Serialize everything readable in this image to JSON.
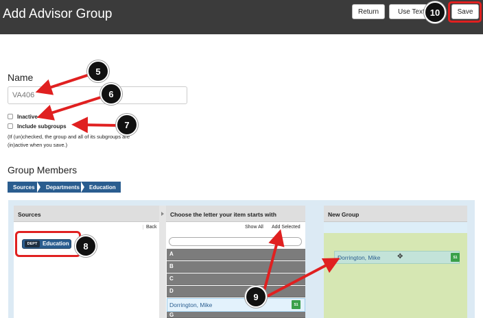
{
  "header": {
    "title": "Add Advisor Group",
    "return_label": "Return",
    "use_text_label": "Use Text",
    "save_label": "Save"
  },
  "form": {
    "name_label": "Name",
    "name_value": "VA406",
    "inactive_label": "Inactive",
    "include_subgroups_label": "Include subgroups",
    "help_text": "(If (un)checked, the group and all of its subgroups are (in)active when you save.)"
  },
  "members": {
    "title": "Group Members",
    "breadcrumb": [
      "Sources",
      "Departments",
      "Education"
    ]
  },
  "sources_panel": {
    "title": "Sources",
    "back_label": "Back",
    "item_tag": "DEPT",
    "item_label": "Education"
  },
  "letters_panel": {
    "title": "Choose the letter your item starts with",
    "show_all_label": "Show All",
    "add_selected_label": "Add Selected",
    "letters": [
      "A",
      "B",
      "C",
      "D"
    ],
    "selected_item": "Dorrington, Mike",
    "selected_badge": "S1",
    "next_letter": "G"
  },
  "new_group_panel": {
    "title": "New Group",
    "member_name": "Dorrington, Mike",
    "member_badge": "S1"
  },
  "callouts": [
    "5",
    "6",
    "7",
    "8",
    "9",
    "10"
  ],
  "colors": {
    "header_bg": "#3b3b3b",
    "annotation_red": "#e02020",
    "breadcrumb_blue": "#2a5d8f",
    "group_green": "#d6e7b3",
    "badge_green": "#3aa04a"
  }
}
